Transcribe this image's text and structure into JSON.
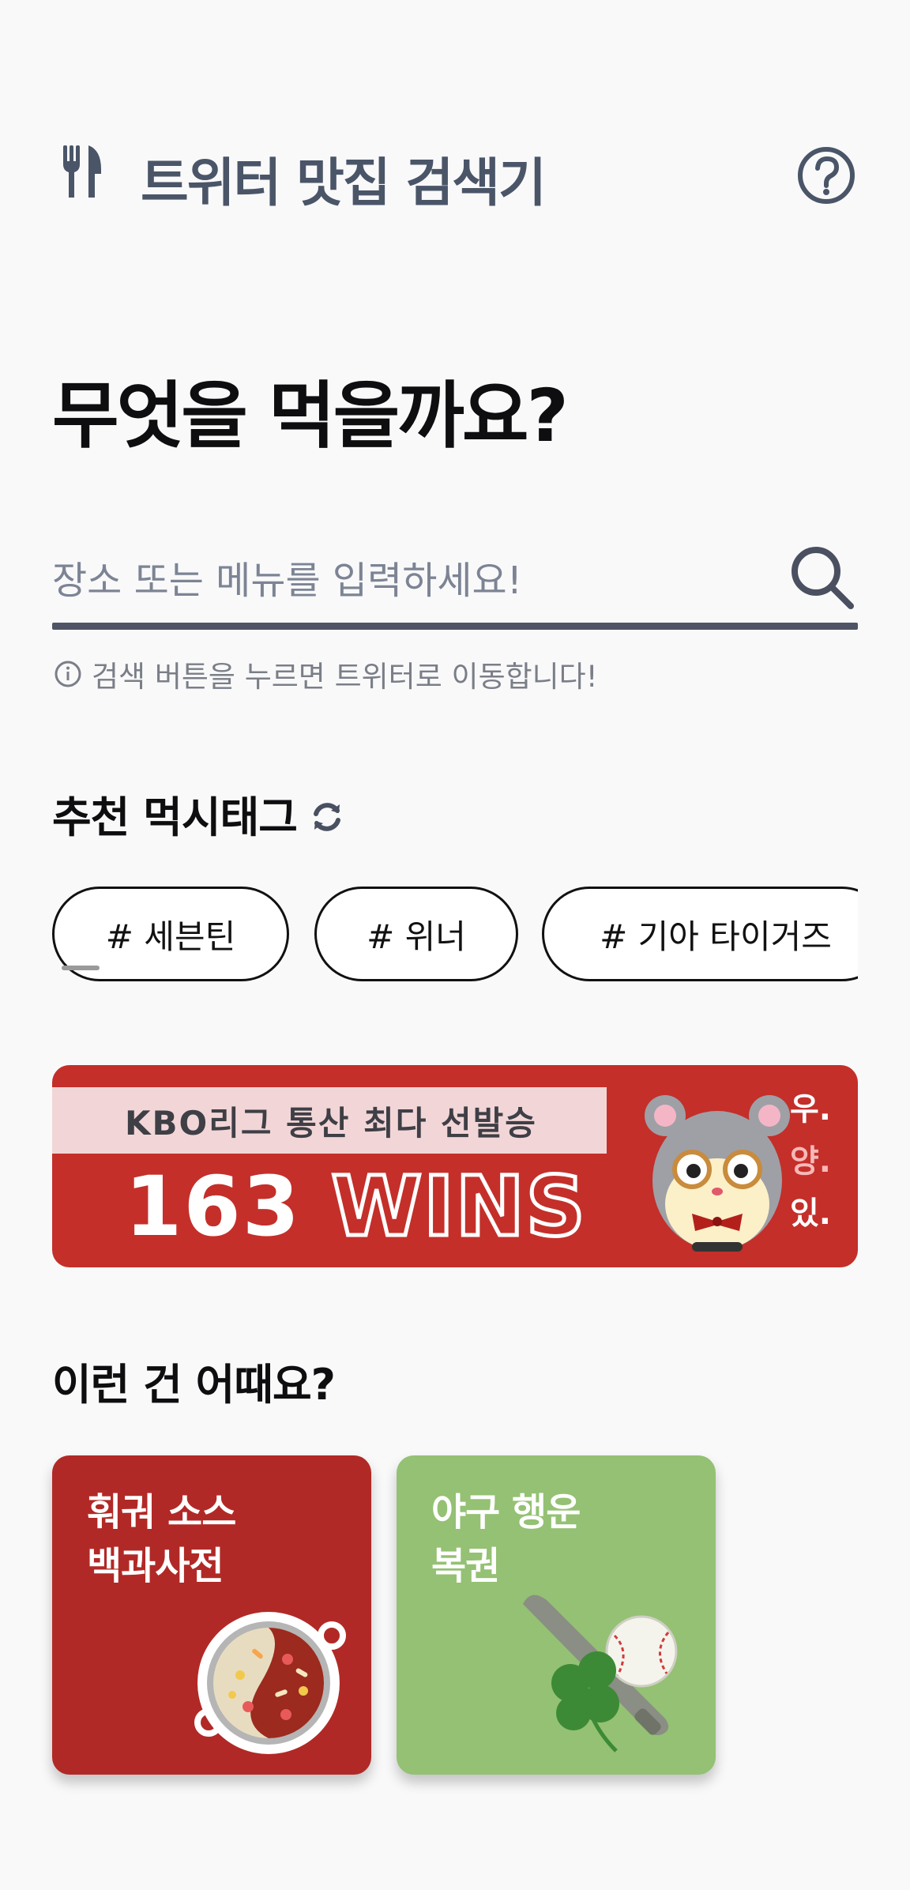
{
  "header": {
    "title": "트위터 맛집 검색기",
    "logo_icon": "fork-knife-icon",
    "help_icon": "help-circle-icon"
  },
  "main": {
    "heading": "무엇을 먹을까요?"
  },
  "search": {
    "placeholder": "장소 또는 메뉴를 입력하세요!",
    "value": "",
    "hint": "검색 버튼을 누르면 트위터로 이동합니다!",
    "button_icon": "search-icon",
    "hint_icon": "info-icon"
  },
  "recommended": {
    "title": "추천 먹시태그",
    "refresh_icon": "refresh-icon",
    "tags": [
      "# 세븐틴",
      "# 위너",
      "# 기아 타이거즈"
    ]
  },
  "banner": {
    "ribbon_text": "KBO리그 통산 최다 선발승",
    "big_number": "163",
    "big_word": "WINS",
    "vertical": [
      "우.",
      "양.",
      "있."
    ],
    "colors": {
      "background": "#c42f2a",
      "ribbon": "#f2d6d7"
    }
  },
  "suggestions": {
    "title": "이런 건 어때요?",
    "cards": [
      {
        "title": "훠궈 소스\n백과사전",
        "color": "#b12926",
        "icon": "hotpot-icon"
      },
      {
        "title": "야구 행운\n복권",
        "color": "#94c173",
        "icon": "clover-baseball-icon"
      }
    ]
  }
}
